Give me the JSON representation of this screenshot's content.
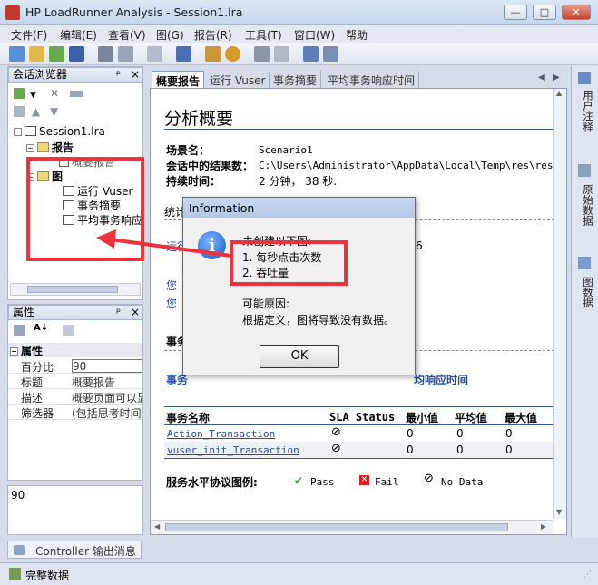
{
  "window": {
    "title": "HP LoadRunner Analysis - Session1.lra",
    "min": "—",
    "max": "□",
    "close": "✕"
  },
  "menu": [
    "文件(F)",
    "编辑(E)",
    "查看(V)",
    "图(G)",
    "报告(R)",
    "工具(T)",
    "窗口(W)",
    "帮助"
  ],
  "session_browser": {
    "title": "会话浏览器",
    "pin": "ᵖ",
    "close": "×",
    "root": "Session1.lra",
    "report_folder": "报告",
    "report_item": "概要报告",
    "graph_folder": "图",
    "graphs": [
      "运行 Vuser",
      "事务摘要",
      "平均事务响应"
    ]
  },
  "properties": {
    "title": "属性",
    "section": "属性",
    "rows": [
      {
        "key": "百分比",
        "value": "90"
      },
      {
        "key": "标题",
        "value": "概要报告"
      },
      {
        "key": "描述",
        "value": "概要页面可以显"
      },
      {
        "key": "筛选器",
        "value": "(包括思考时间"
      }
    ],
    "output_value": "90"
  },
  "tabs": [
    "概要报告",
    "运行 Vuser",
    "事务摘要",
    "平均事务响应时间"
  ],
  "summary": {
    "heading": "分析概要",
    "scenario_label": "场景名：",
    "scenario_value": "Scenario1",
    "results_label": "会话中的结果数：",
    "results_value": "C:\\Users\\Administrator\\AppData\\Local\\Temp\\res\\res.lrr",
    "duration_label": "持续时间：",
    "duration_value": "2 分钟， 38 秒.",
    "stats_label": "统计",
    "run_label": "运行",
    "run_value": "6",
    "you1": "您",
    "you2": "您",
    "trans_label": "事务",
    "trans_link_left": "事务",
    "trans_link_right": "均响应时间",
    "table_headers": [
      "事务名称",
      "SLA Status",
      "最小值",
      "平均值",
      "最大值"
    ],
    "table_rows": [
      {
        "name": "Action_Transaction",
        "min": "0",
        "avg": "0",
        "max": "0"
      },
      {
        "name": "vuser_init_Transaction",
        "min": "0",
        "avg": "0",
        "max": "0"
      }
    ],
    "legend_label": "服务水平协议图例:",
    "legend_pass": "Pass",
    "legend_fail": "Fail",
    "legend_nodata": "No Data"
  },
  "right_tabs": [
    "用户注释",
    "原始数据",
    "图数据"
  ],
  "dialog": {
    "title": "Information",
    "icon": "i",
    "line1": "未创建以下图:",
    "item1": "1. 每秒点击次数",
    "item2": "2. 吞吐量",
    "reason_label": "可能原因:",
    "reason_text": "根据定义，图将导致没有数据。",
    "ok": "OK"
  },
  "bottom": {
    "output_tab": "Controller 输出消息",
    "status": "完整数据"
  },
  "annotation_color": "#f0323c"
}
